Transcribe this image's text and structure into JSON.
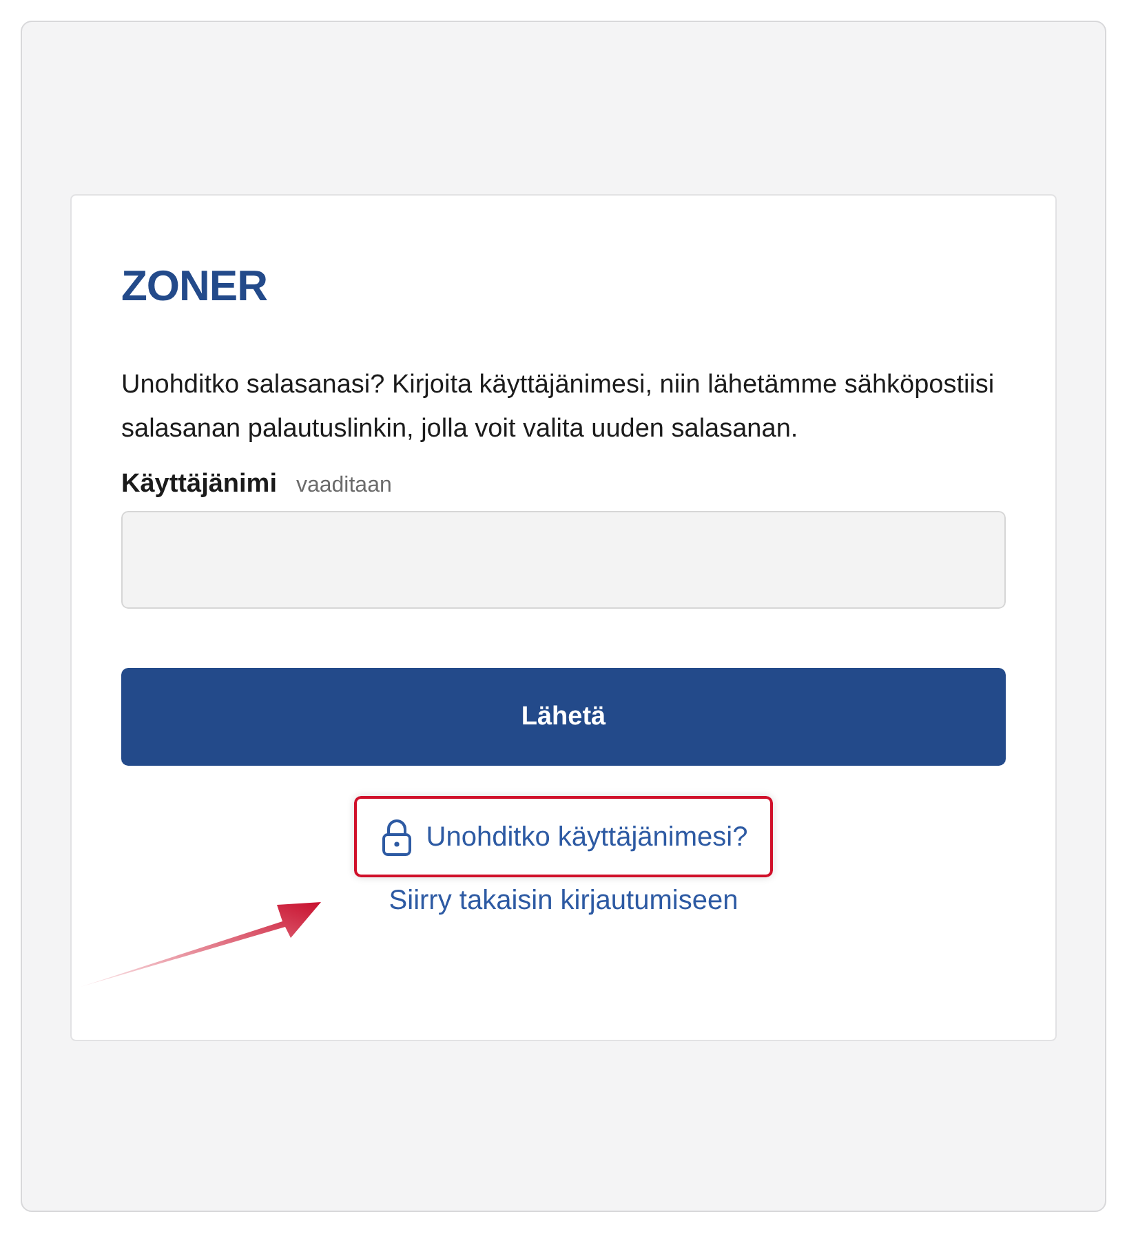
{
  "logo": {
    "text": "ZONER"
  },
  "intro": "Unohditko salasanasi? Kirjoita käyttäjänimesi, niin lähetämme sähköpostiisi salasanan palautuslinkin, jolla voit valita uuden salasanan.",
  "username_field": {
    "label": "Käyttäjänimi",
    "hint": "vaaditaan"
  },
  "submit_button": {
    "label": "Lähetä"
  },
  "links": [
    {
      "label": "Unohditko käyttäjänimesi?",
      "kind": "lock",
      "highlighted": true
    },
    {
      "label": "Siirry takaisin kirjautumiseen",
      "kind": "plain",
      "highlighted": false
    }
  ]
}
